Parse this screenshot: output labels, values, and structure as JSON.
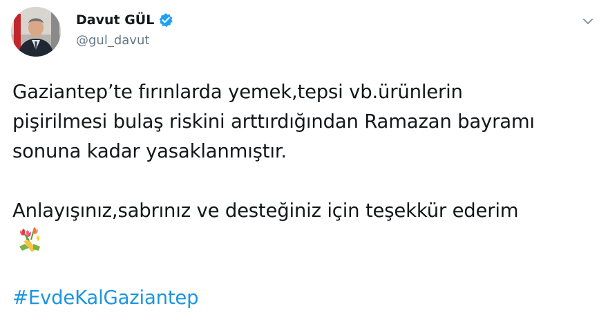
{
  "author": {
    "display_name": "Davut GÜL",
    "handle": "@gul_davut",
    "verified_icon": "verified-badge-icon",
    "verified_color": "#1da1f2"
  },
  "menu": {
    "icon": "chevron-down-icon"
  },
  "tweet": {
    "line1": "Gaziantep’te fırınlarda yemek,tepsi vb.ürünlerin",
    "line2": "pişirilmesi bulaş riskini arttırdığından Ramazan bayramı",
    "line3": "sonuna kadar yasaklanmıştır.",
    "line4": "Anlayışınız,sabrınız ve desteğiniz için teşekkür ederim",
    "emoji": "bouquet-of-tulips-emoji",
    "hashtag": "#EvdeKalGaziantep",
    "hashtag_color": "#1b95e0"
  }
}
